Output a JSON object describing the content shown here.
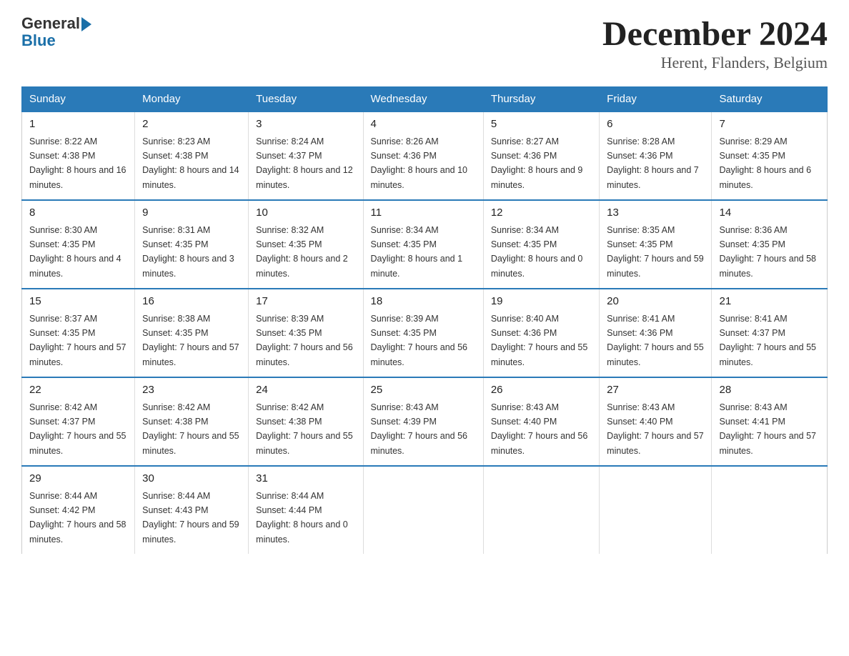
{
  "logo": {
    "general": "General",
    "blue": "Blue"
  },
  "title": {
    "month_year": "December 2024",
    "location": "Herent, Flanders, Belgium"
  },
  "headers": [
    "Sunday",
    "Monday",
    "Tuesday",
    "Wednesday",
    "Thursday",
    "Friday",
    "Saturday"
  ],
  "weeks": [
    [
      {
        "day": "1",
        "sunrise": "8:22 AM",
        "sunset": "4:38 PM",
        "daylight": "8 hours and 16 minutes."
      },
      {
        "day": "2",
        "sunrise": "8:23 AM",
        "sunset": "4:38 PM",
        "daylight": "8 hours and 14 minutes."
      },
      {
        "day": "3",
        "sunrise": "8:24 AM",
        "sunset": "4:37 PM",
        "daylight": "8 hours and 12 minutes."
      },
      {
        "day": "4",
        "sunrise": "8:26 AM",
        "sunset": "4:36 PM",
        "daylight": "8 hours and 10 minutes."
      },
      {
        "day": "5",
        "sunrise": "8:27 AM",
        "sunset": "4:36 PM",
        "daylight": "8 hours and 9 minutes."
      },
      {
        "day": "6",
        "sunrise": "8:28 AM",
        "sunset": "4:36 PM",
        "daylight": "8 hours and 7 minutes."
      },
      {
        "day": "7",
        "sunrise": "8:29 AM",
        "sunset": "4:35 PM",
        "daylight": "8 hours and 6 minutes."
      }
    ],
    [
      {
        "day": "8",
        "sunrise": "8:30 AM",
        "sunset": "4:35 PM",
        "daylight": "8 hours and 4 minutes."
      },
      {
        "day": "9",
        "sunrise": "8:31 AM",
        "sunset": "4:35 PM",
        "daylight": "8 hours and 3 minutes."
      },
      {
        "day": "10",
        "sunrise": "8:32 AM",
        "sunset": "4:35 PM",
        "daylight": "8 hours and 2 minutes."
      },
      {
        "day": "11",
        "sunrise": "8:34 AM",
        "sunset": "4:35 PM",
        "daylight": "8 hours and 1 minute."
      },
      {
        "day": "12",
        "sunrise": "8:34 AM",
        "sunset": "4:35 PM",
        "daylight": "8 hours and 0 minutes."
      },
      {
        "day": "13",
        "sunrise": "8:35 AM",
        "sunset": "4:35 PM",
        "daylight": "7 hours and 59 minutes."
      },
      {
        "day": "14",
        "sunrise": "8:36 AM",
        "sunset": "4:35 PM",
        "daylight": "7 hours and 58 minutes."
      }
    ],
    [
      {
        "day": "15",
        "sunrise": "8:37 AM",
        "sunset": "4:35 PM",
        "daylight": "7 hours and 57 minutes."
      },
      {
        "day": "16",
        "sunrise": "8:38 AM",
        "sunset": "4:35 PM",
        "daylight": "7 hours and 57 minutes."
      },
      {
        "day": "17",
        "sunrise": "8:39 AM",
        "sunset": "4:35 PM",
        "daylight": "7 hours and 56 minutes."
      },
      {
        "day": "18",
        "sunrise": "8:39 AM",
        "sunset": "4:35 PM",
        "daylight": "7 hours and 56 minutes."
      },
      {
        "day": "19",
        "sunrise": "8:40 AM",
        "sunset": "4:36 PM",
        "daylight": "7 hours and 55 minutes."
      },
      {
        "day": "20",
        "sunrise": "8:41 AM",
        "sunset": "4:36 PM",
        "daylight": "7 hours and 55 minutes."
      },
      {
        "day": "21",
        "sunrise": "8:41 AM",
        "sunset": "4:37 PM",
        "daylight": "7 hours and 55 minutes."
      }
    ],
    [
      {
        "day": "22",
        "sunrise": "8:42 AM",
        "sunset": "4:37 PM",
        "daylight": "7 hours and 55 minutes."
      },
      {
        "day": "23",
        "sunrise": "8:42 AM",
        "sunset": "4:38 PM",
        "daylight": "7 hours and 55 minutes."
      },
      {
        "day": "24",
        "sunrise": "8:42 AM",
        "sunset": "4:38 PM",
        "daylight": "7 hours and 55 minutes."
      },
      {
        "day": "25",
        "sunrise": "8:43 AM",
        "sunset": "4:39 PM",
        "daylight": "7 hours and 56 minutes."
      },
      {
        "day": "26",
        "sunrise": "8:43 AM",
        "sunset": "4:40 PM",
        "daylight": "7 hours and 56 minutes."
      },
      {
        "day": "27",
        "sunrise": "8:43 AM",
        "sunset": "4:40 PM",
        "daylight": "7 hours and 57 minutes."
      },
      {
        "day": "28",
        "sunrise": "8:43 AM",
        "sunset": "4:41 PM",
        "daylight": "7 hours and 57 minutes."
      }
    ],
    [
      {
        "day": "29",
        "sunrise": "8:44 AM",
        "sunset": "4:42 PM",
        "daylight": "7 hours and 58 minutes."
      },
      {
        "day": "30",
        "sunrise": "8:44 AM",
        "sunset": "4:43 PM",
        "daylight": "7 hours and 59 minutes."
      },
      {
        "day": "31",
        "sunrise": "8:44 AM",
        "sunset": "4:44 PM",
        "daylight": "8 hours and 0 minutes."
      },
      null,
      null,
      null,
      null
    ]
  ]
}
